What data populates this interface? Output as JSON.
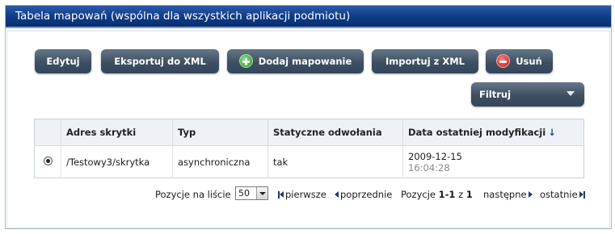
{
  "window": {
    "title": "Tabela mapowań (wspólna dla wszystkich aplikacji podmiotu)"
  },
  "toolbar": {
    "edit_label": "Edytuj",
    "export_label": "Eksportuj do XML",
    "add_label": "Dodaj mapowanie",
    "import_label": "Importuj z XML",
    "delete_label": "Usuń",
    "add_icon": "plus-circle-icon",
    "delete_icon": "minus-circle-icon"
  },
  "filter": {
    "label": "Filtruj",
    "icon": "chevron-down-icon"
  },
  "table": {
    "columns": [
      "Adres skrytki",
      "Typ",
      "Statyczne odwołania",
      "Data ostatniej modyfikacji"
    ],
    "sort_indicator": "↓",
    "rows": [
      {
        "selected": true,
        "address": "/Testowy3/skrytka",
        "type": "asynchroniczna",
        "static_refs": "tak",
        "date": "2009-12-15",
        "time": "16:04:28"
      }
    ]
  },
  "pager": {
    "per_page_label": "Pozycje na liście",
    "per_page_value": "50",
    "first": "pierwsze",
    "prev": "poprzednie",
    "positions_prefix": "Pozycje",
    "range": "1-1",
    "of": "z",
    "total": "1",
    "next": "następne",
    "last": "ostatnie"
  },
  "colors": {
    "title_bar": "#0d3a86",
    "button": "#3e4f62",
    "add_icon": "#1f9a1f",
    "delete_icon": "#c01818",
    "header_bg": "#eef1f5"
  }
}
